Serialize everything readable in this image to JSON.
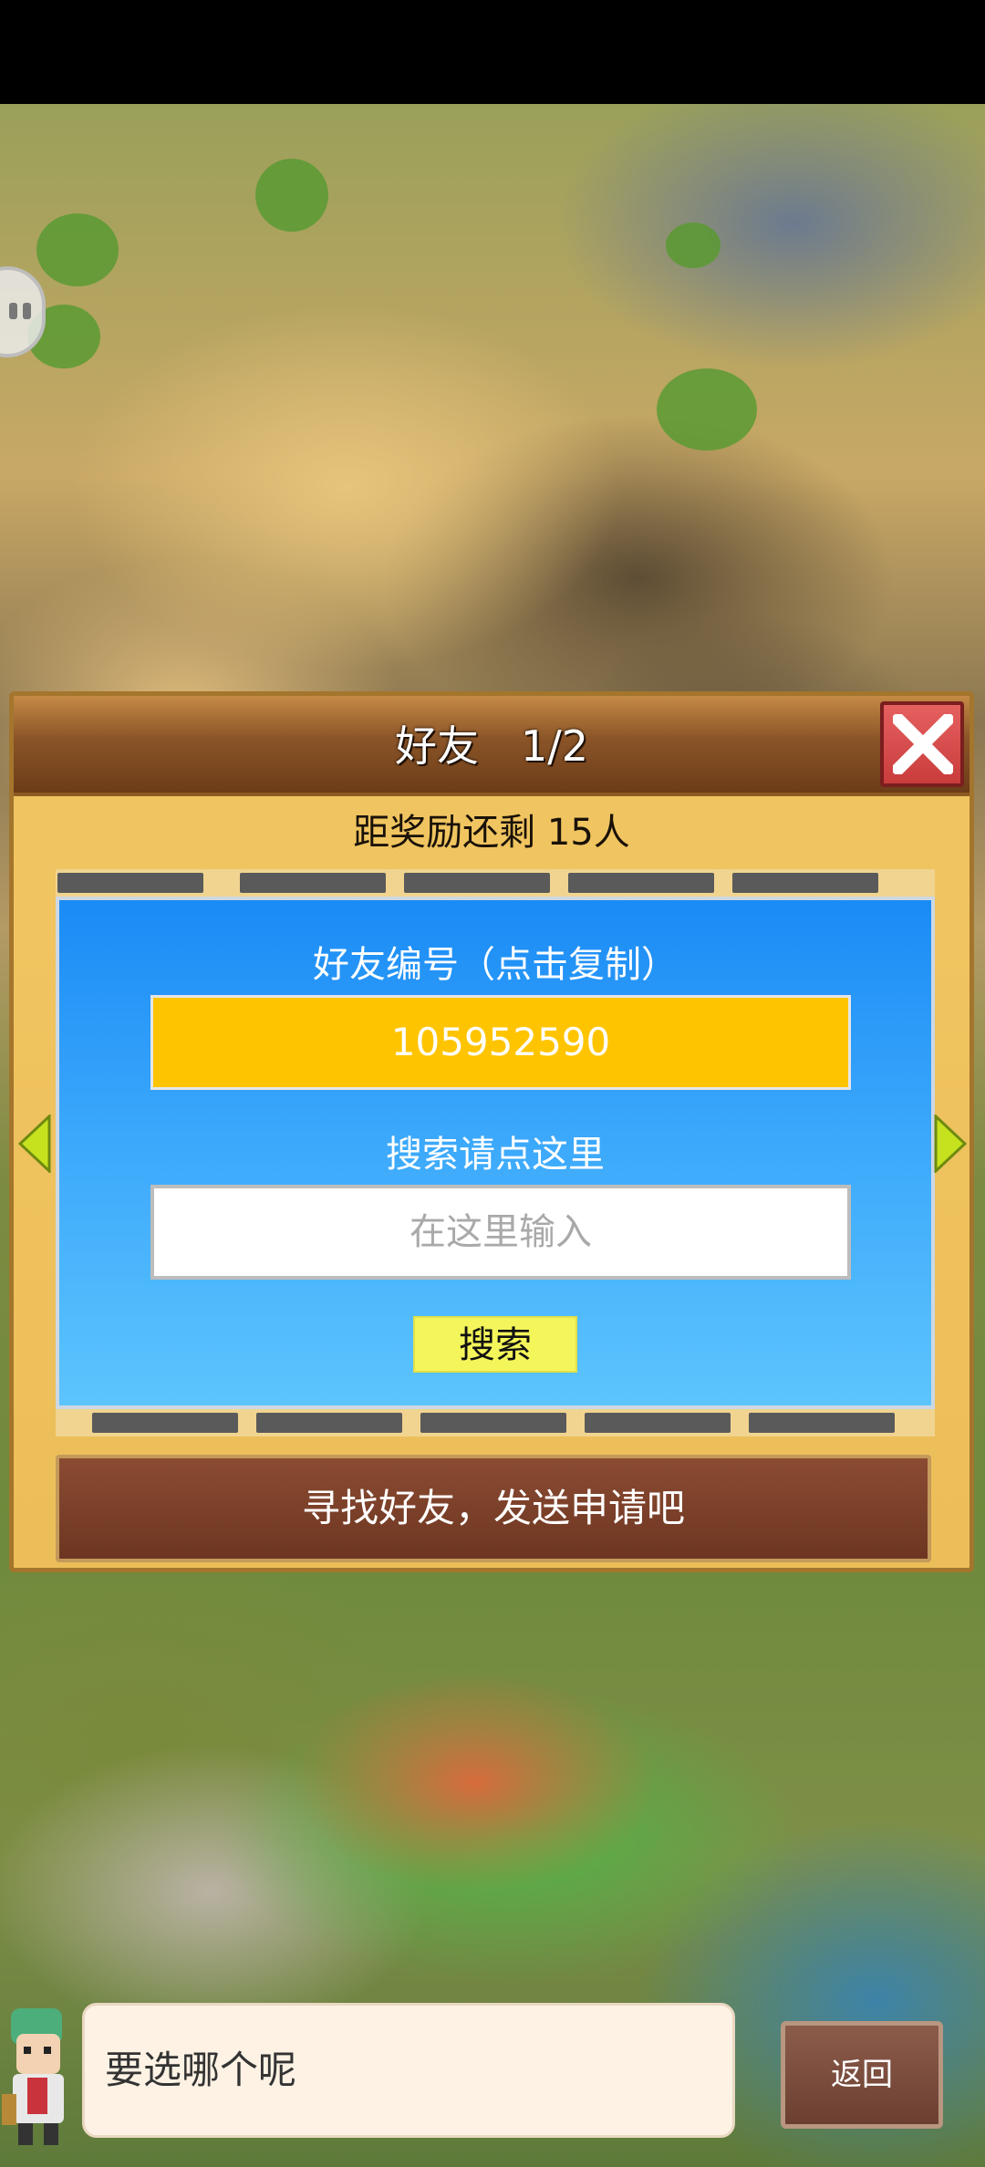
{
  "dialog": {
    "title": "好友　1/2",
    "reward_remaining": "距奖励还剩 15人",
    "friend_id_label": "好友编号（点击复制）",
    "friend_id": "105952590",
    "search_label": "搜索请点这里",
    "search_placeholder": "在这里输入",
    "search_button": "搜索",
    "find_friends_button": "寻找好友，发送申请吧"
  },
  "dialogue": {
    "speech": "要选哪个呢",
    "back_button": "返回"
  },
  "colors": {
    "friend_id_bg": "#ffc400",
    "panel_blue": "#1a8bf5",
    "close_red": "#c93c3c",
    "search_button_bg": "#f4f55a"
  },
  "icons": [
    "pause-icon",
    "close-icon",
    "arrow-left-icon",
    "arrow-right-icon"
  ]
}
